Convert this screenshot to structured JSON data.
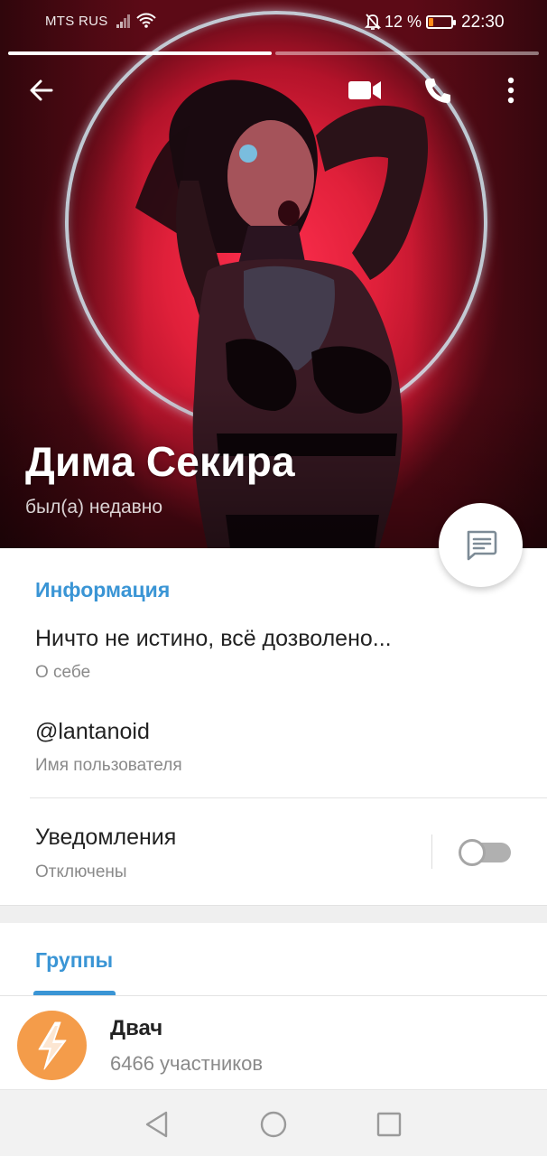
{
  "status_bar": {
    "carrier": "MTS RUS",
    "battery_percent": "12 %",
    "time": "22:30"
  },
  "story_progress": {
    "segments": 2,
    "current": 1
  },
  "profile": {
    "name": "Дима Секира",
    "status": "был(а) недавно"
  },
  "info": {
    "section_title": "Информация",
    "about_text": "Ничто не истино, всё дозволено...",
    "about_label": "О себе",
    "username": "@lantanoid",
    "username_label": "Имя пользователя",
    "notifications_title": "Уведомления",
    "notifications_state": "Отключены",
    "notifications_enabled": false
  },
  "groups": {
    "section_title": "Группы",
    "items": [
      {
        "name": "Двач",
        "members": "6466 участников",
        "avatar_color": "#f49c4a"
      }
    ]
  },
  "colors": {
    "accent": "#3a95d5",
    "photo_red": "#e0203a",
    "battery_low": "#ff8a1a"
  },
  "icons": {
    "toolbar": [
      "back-arrow-icon",
      "video-camera-icon",
      "phone-icon",
      "more-vertical-icon"
    ],
    "fab": "message-icon",
    "navbar": [
      "nav-back-icon",
      "nav-home-icon",
      "nav-recents-icon"
    ]
  }
}
